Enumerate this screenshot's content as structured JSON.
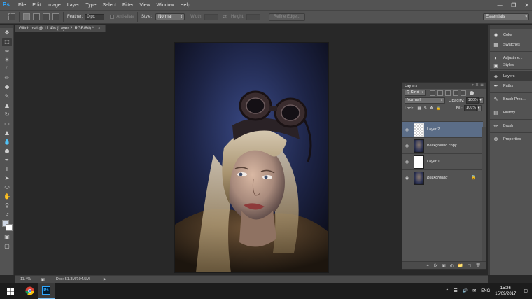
{
  "app": {
    "logo": "Ps",
    "menus": [
      "File",
      "Edit",
      "Image",
      "Layer",
      "Type",
      "Select",
      "Filter",
      "View",
      "Window",
      "Help"
    ],
    "window_controls": [
      "minimize-icon",
      "restore-icon",
      "close-icon"
    ]
  },
  "options_bar": {
    "feather_label": "Feather:",
    "feather_value": "0 px",
    "antialias_label": "Anti-alias",
    "style_label": "Style:",
    "style_value": "Normal",
    "width_label": "Width:",
    "height_label": "Height:",
    "refine_edge_label": "Refine Edge...",
    "workspace_value": "Essentials"
  },
  "document": {
    "tab_title": "Glitch.psd @ 11.4% (Layer 2, RGB/8#) *",
    "close": "×"
  },
  "status_bar": {
    "zoom": "11.4%",
    "doc_info": "Doc: 51.3M/104.5M"
  },
  "layers_panel": {
    "title": "Layers",
    "filter_value": "Kind",
    "blend_mode": "Normal",
    "opacity_label": "Opacity:",
    "opacity_value": "100%",
    "lock_label": "Lock:",
    "fill_label": "Fill:",
    "fill_value": "100%",
    "layers": [
      {
        "name": "Layer 2",
        "thumb": "checker",
        "selected": true
      },
      {
        "name": "Background copy",
        "thumb": "photo",
        "selected": false
      },
      {
        "name": "Layer 1",
        "thumb": "white",
        "selected": false
      },
      {
        "name": "Background",
        "thumb": "photo",
        "selected": false,
        "italic": true,
        "locked": true
      }
    ],
    "footer_icons": [
      "link-icon",
      "fx-icon",
      "mask-icon",
      "adjustment-icon",
      "group-folder-icon",
      "new-layer-icon",
      "trash-icon"
    ]
  },
  "right_panels": {
    "group1": [
      {
        "label": "Color",
        "icon": "color-wheel-icon"
      },
      {
        "label": "Swatches",
        "icon": "swatches-grid-icon"
      }
    ],
    "group2": [
      {
        "label": "Adjustme...",
        "icon": "adjustments-icon"
      },
      {
        "label": "Styles",
        "icon": "styles-icon"
      }
    ],
    "group3": [
      {
        "label": "Layers",
        "icon": "layers-icon",
        "selected": true
      },
      {
        "label": "Paths",
        "icon": "paths-icon"
      }
    ],
    "group4": [
      {
        "label": "Brush Pres...",
        "icon": "brush-presets-icon"
      }
    ],
    "group5": [
      {
        "label": "History",
        "icon": "history-icon"
      }
    ],
    "group6": [
      {
        "label": "Brush",
        "icon": "brush-icon"
      }
    ],
    "group7": [
      {
        "label": "Properties",
        "icon": "properties-icon"
      }
    ]
  },
  "taskbar": {
    "language": "ENG",
    "time": "15:26",
    "date": "15/09/2017"
  }
}
